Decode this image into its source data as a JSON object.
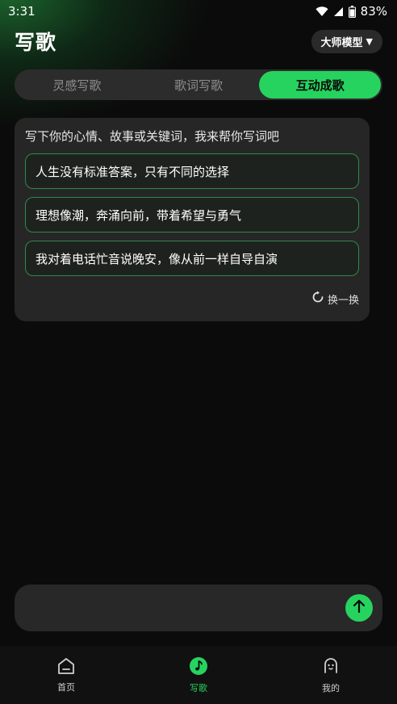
{
  "status": {
    "time": "3:31",
    "battery": "83%"
  },
  "header": {
    "title": "写歌",
    "model_label": "大师模型",
    "model_caret": "▼"
  },
  "tabs": [
    {
      "label": "灵感写歌",
      "active": false
    },
    {
      "label": "歌词写歌",
      "active": false
    },
    {
      "label": "互动成歌",
      "active": true
    }
  ],
  "card": {
    "prompt": "写下你的心情、故事或关键词，我来帮你写词吧",
    "suggestions": [
      "人生没有标准答案，只有不同的选择",
      "理想像潮，奔涌向前，带着希望与勇气",
      "我对着电话忙音说晚安，像从前一样自导自演"
    ],
    "refresh_label": "换一换"
  },
  "input": {
    "placeholder": "",
    "value": ""
  },
  "nav": [
    {
      "label": "首页",
      "icon": "home-icon",
      "active": false
    },
    {
      "label": "写歌",
      "icon": "music-note-icon",
      "active": true
    },
    {
      "label": "我的",
      "icon": "profile-icon",
      "active": false
    }
  ],
  "colors": {
    "accent": "#27d35f",
    "background": "#0b0b0b",
    "card": "#262626"
  }
}
